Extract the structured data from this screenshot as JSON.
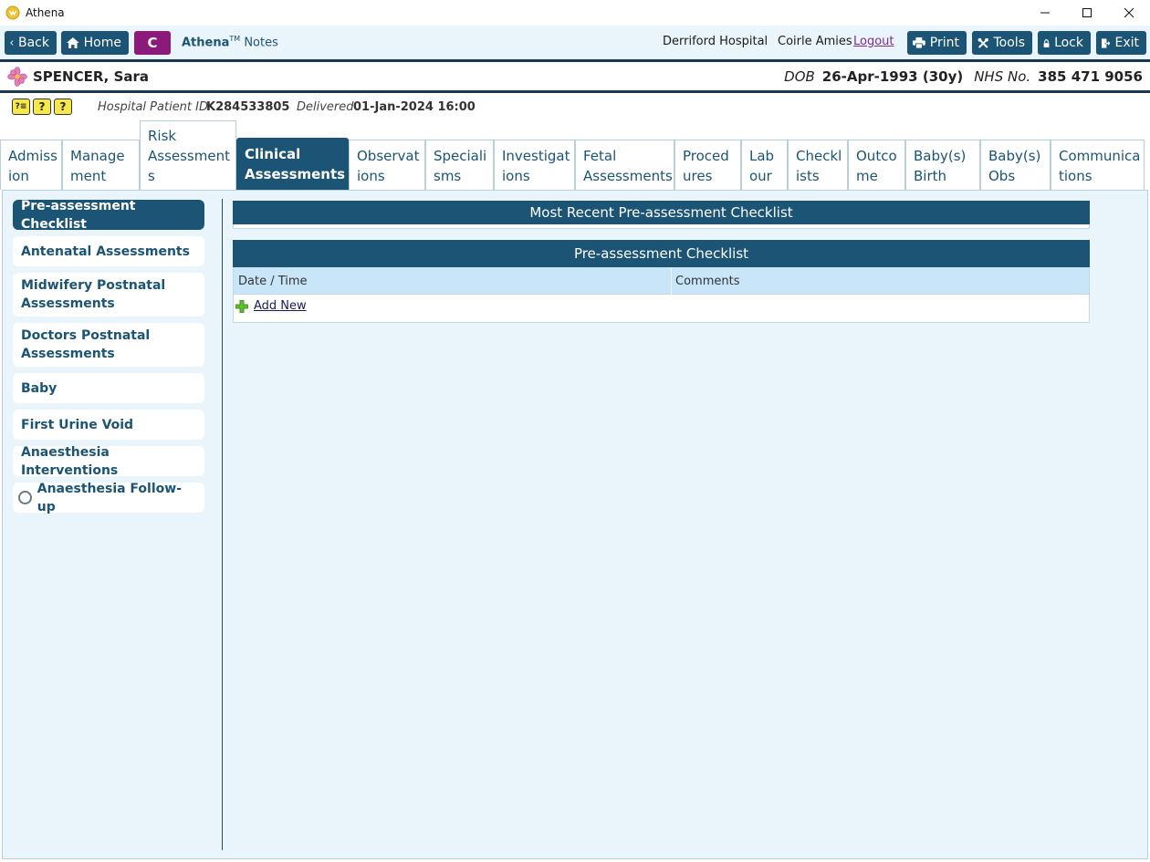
{
  "window": {
    "title": "Athena"
  },
  "toolbar": {
    "back_label": "Back",
    "home_label": "Home",
    "c_label": "C",
    "brand_name": "Athena",
    "brand_tm": "TM",
    "brand_suffix": "Notes",
    "hospital": "Derriford Hospital",
    "user": "Coirle Amies",
    "logout_label": "Logout",
    "print_label": "Print",
    "tools_label": "Tools",
    "lock_label": "Lock",
    "exit_label": "Exit"
  },
  "patient": {
    "name": "SPENCER, Sara",
    "dob_label": "DOB",
    "dob_value": "26-Apr-1993 (30y)",
    "nhs_label": "NHS No.",
    "nhs_value": "385 471 9056",
    "hospital_id_label": "Hospital Patient ID",
    "hospital_id_value": "K284533805",
    "delivered_label": "Delivered",
    "delivered_value": "01-Jan-2024 16:00",
    "alerts": [
      "?≡",
      "?",
      "?"
    ]
  },
  "tabs": [
    {
      "label": "Admiss ion"
    },
    {
      "label": "Manage ment"
    },
    {
      "label": "Risk Assessment s"
    },
    {
      "label": "Clinical Assessments"
    },
    {
      "label": "Observat ions"
    },
    {
      "label": "Speciali sms"
    },
    {
      "label": "Investigat ions"
    },
    {
      "label": "Fetal Assessments"
    },
    {
      "label": "Proced ures"
    },
    {
      "label": "Lab our"
    },
    {
      "label": "Checkl ists"
    },
    {
      "label": "Outco me"
    },
    {
      "label": "Baby(s) Birth"
    },
    {
      "label": "Baby(s) Obs"
    },
    {
      "label": "Communica tions"
    }
  ],
  "active_tab": "Clinical Assessments",
  "sidebar": {
    "items": [
      {
        "label": "Pre-assessment Checklist"
      },
      {
        "label": "Antenatal Assessments"
      },
      {
        "label": "Midwifery Postnatal Assessments"
      },
      {
        "label": "Doctors Postnatal Assessments"
      },
      {
        "label": "Baby"
      },
      {
        "label": "First Urine Void"
      },
      {
        "label": "Anaesthesia Interventions"
      },
      {
        "label": "Anaesthesia Follow-up"
      }
    ],
    "active": "Pre-assessment Checklist"
  },
  "main": {
    "recent_header": "Most Recent Pre-assessment Checklist",
    "checklist_header": "Pre-assessment Checklist",
    "columns": [
      "Date / Time",
      "Comments"
    ],
    "add_new_label": "Add New"
  },
  "colors": {
    "primary": "#1b5475",
    "background": "#e9f5fb",
    "table_header": "#c8e6f8",
    "c_badge": "#8b1a7b"
  }
}
